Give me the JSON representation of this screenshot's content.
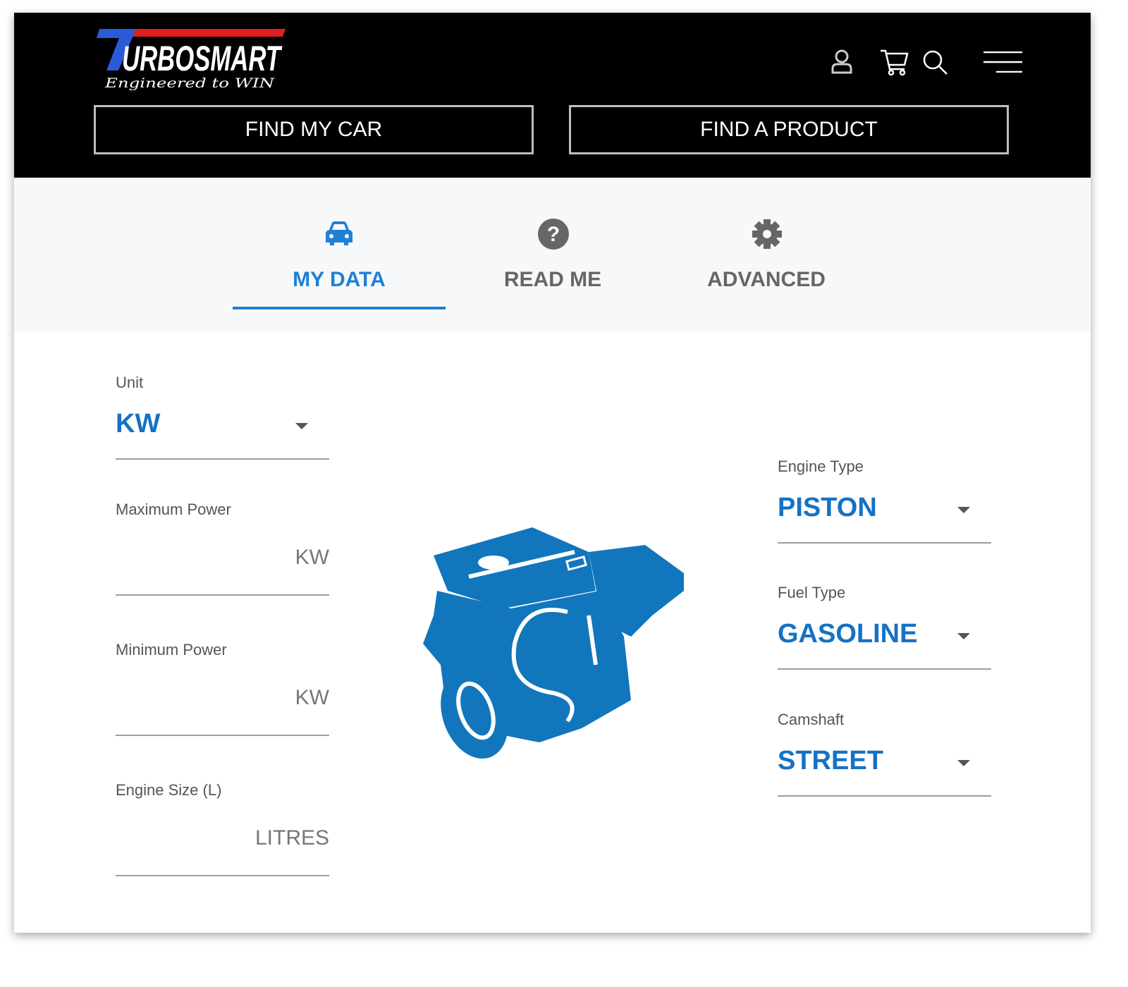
{
  "header": {
    "logo_text": "TURBOSMART",
    "logo_tagline": "Engineered to WIN",
    "find_my_car": "FIND MY CAR",
    "find_a_product": "FIND A PRODUCT",
    "icons": [
      "user-icon",
      "cart-icon",
      "search-icon",
      "menu-icon"
    ]
  },
  "tabs": [
    {
      "label": "MY DATA",
      "icon": "car-icon",
      "active": true
    },
    {
      "label": "READ ME",
      "icon": "help-icon",
      "active": false
    },
    {
      "label": "ADVANCED",
      "icon": "gear-icon",
      "active": false
    }
  ],
  "form": {
    "unit": {
      "label": "Unit",
      "value": "KW"
    },
    "max_power": {
      "label": "Maximum Power",
      "unit": "KW",
      "value": ""
    },
    "min_power": {
      "label": "Minimum Power",
      "unit": "KW",
      "value": ""
    },
    "engine_size": {
      "label": "Engine Size (L)",
      "unit": "LITRES",
      "value": ""
    },
    "engine_type": {
      "label": "Engine Type",
      "value": "PISTON"
    },
    "fuel_type": {
      "label": "Fuel Type",
      "value": "GASOLINE"
    },
    "camshaft": {
      "label": "Camshaft",
      "value": "STREET"
    }
  },
  "colors": {
    "accent": "#1f80d6",
    "value": "#1572c4",
    "engine": "#1176bc",
    "header_bg": "#000000"
  }
}
